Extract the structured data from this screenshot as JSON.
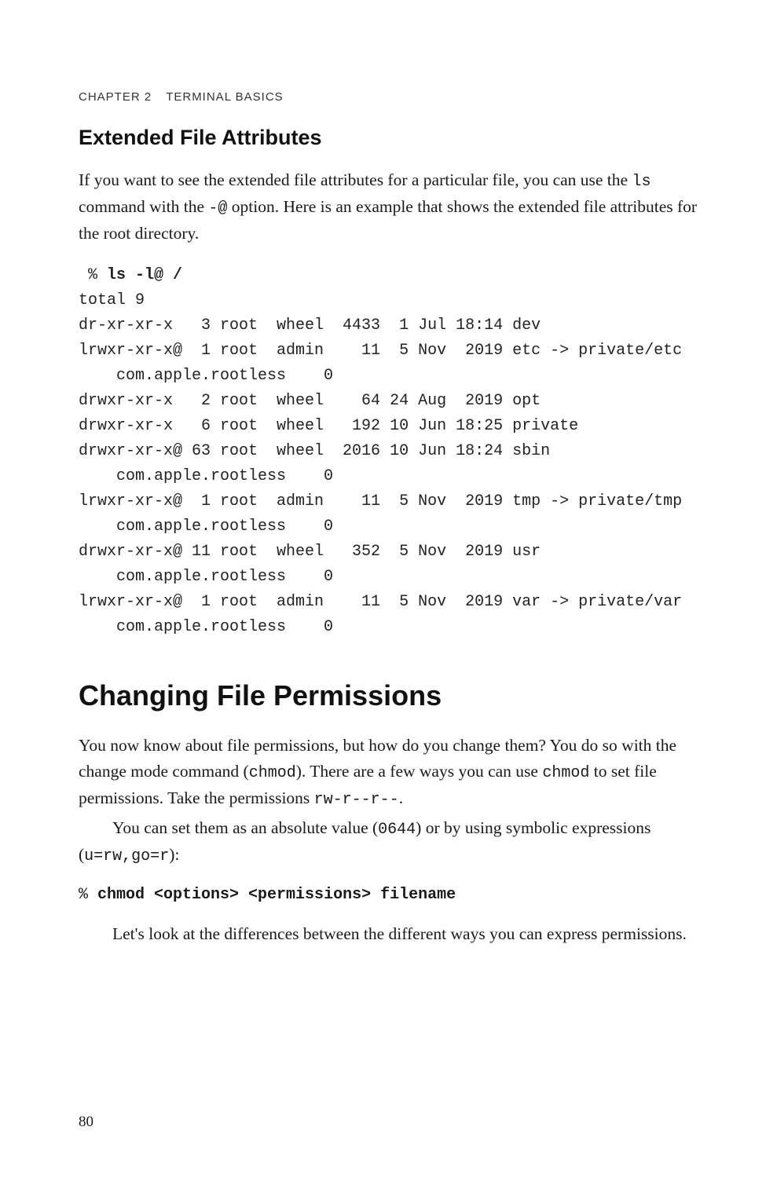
{
  "header": {
    "chapter_label": "CHAPTER 2",
    "chapter_title": "TERMINAL BASICS"
  },
  "section1": {
    "heading": "Extended File Attributes",
    "para1_a": "If you want to see the extended file attributes for a particular file, you can use the ",
    "para1_code1": "ls",
    "para1_b": " command with the ",
    "para1_code2": "-@",
    "para1_c": " option. Here is an example that shows the extended file attributes for the root directory.",
    "prompt": " % ",
    "command": "ls -l@ /",
    "output": "total 9\ndr-xr-xr-x   3 root  wheel  4433  1 Jul 18:14 dev\nlrwxr-xr-x@  1 root  admin    11  5 Nov  2019 etc -> private/etc\n    com.apple.rootless    0\ndrwxr-xr-x   2 root  wheel    64 24 Aug  2019 opt\ndrwxr-xr-x   6 root  wheel   192 10 Jun 18:25 private\ndrwxr-xr-x@ 63 root  wheel  2016 10 Jun 18:24 sbin\n    com.apple.rootless    0\nlrwxr-xr-x@  1 root  admin    11  5 Nov  2019 tmp -> private/tmp\n    com.apple.rootless    0\ndrwxr-xr-x@ 11 root  wheel   352  5 Nov  2019 usr\n    com.apple.rootless    0\nlrwxr-xr-x@  1 root  admin    11  5 Nov  2019 var -> private/var\n    com.apple.rootless    0"
  },
  "section2": {
    "heading": "Changing File Permissions",
    "para1_a": "You now know about file permissions, but how do you change them? You do so with the change mode command (",
    "para1_code1": "chmod",
    "para1_b": "). There are a few ways you can use ",
    "para1_code2": "chmod",
    "para1_c": " to set file permissions. Take the permissions ",
    "para1_code3": "rw-r--r--",
    "para1_d": ".",
    "para2_a": "You can set them as an absolute value (",
    "para2_code1": "0644",
    "para2_b": ") or by using symbolic expressions (",
    "para2_code2": "u=rw,go=r",
    "para2_c": "):",
    "cmd_prompt": "% ",
    "cmd": "chmod <options> <permissions> filename",
    "para3": "Let's look at the differences between the different ways you can express permissions."
  },
  "page_number": "80"
}
